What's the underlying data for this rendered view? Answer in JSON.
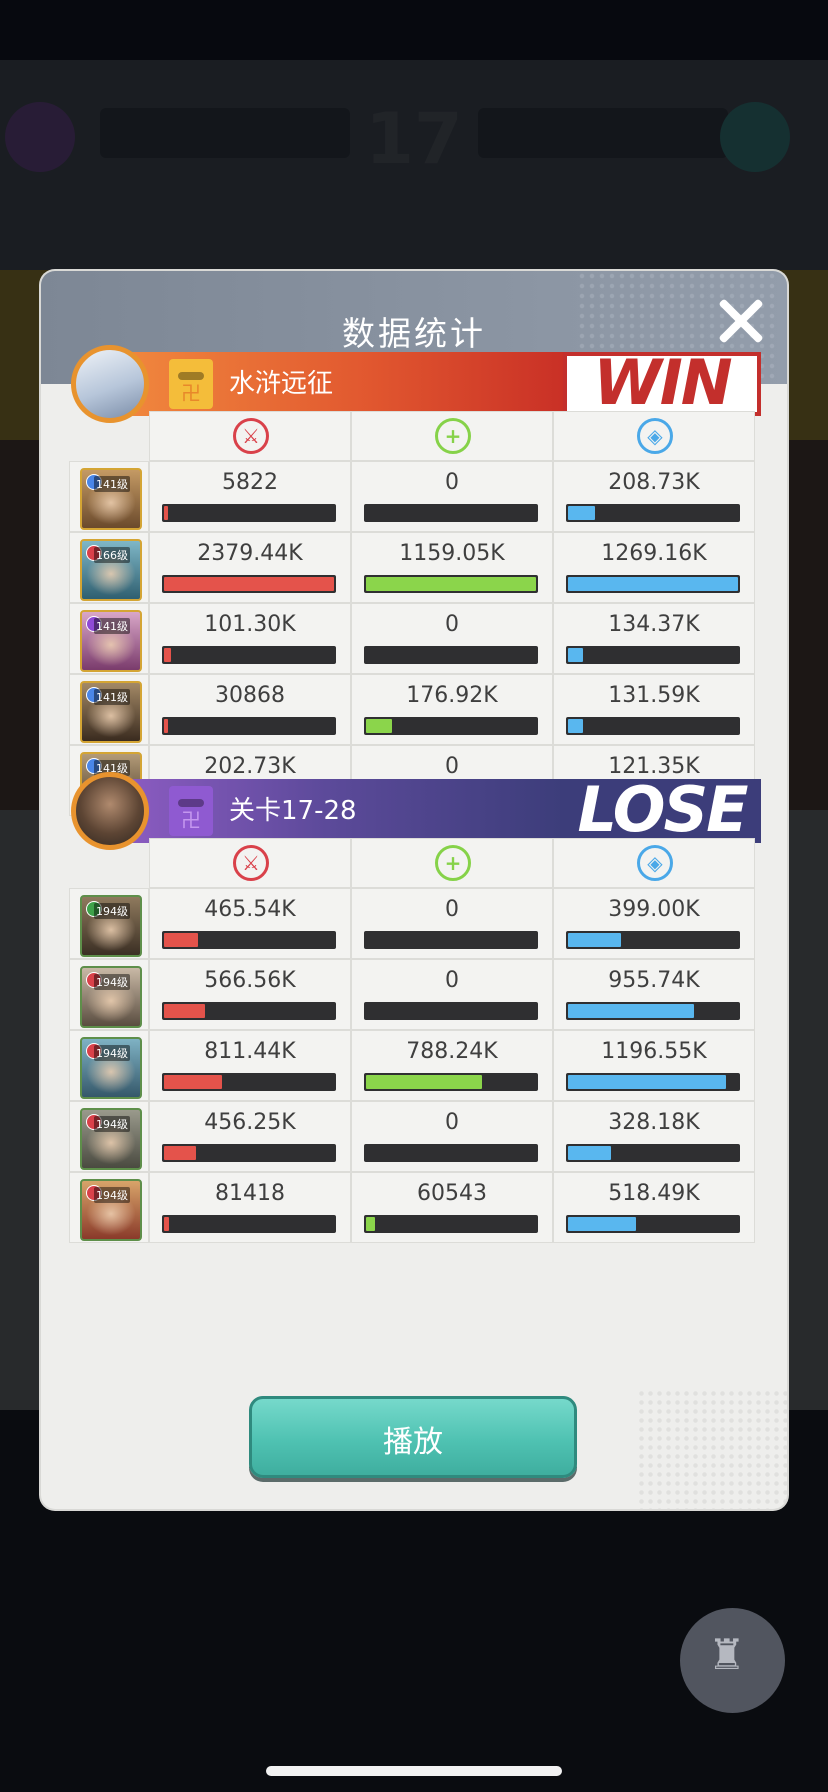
{
  "header": {
    "title": "数据统计"
  },
  "teams": [
    {
      "name": "水浒远征",
      "result": "WIN",
      "heroes": [
        {
          "level": "141级",
          "element": "#4a86e8",
          "dmg": "5822",
          "heal": "0",
          "tank": "208.73K",
          "dmg_frac": 0.002,
          "heal_frac": 0.0,
          "tank_frac": 0.16
        },
        {
          "level": "166级",
          "element": "#d9414a",
          "dmg": "2379.44K",
          "heal": "1159.05K",
          "tank": "1269.16K",
          "dmg_frac": 1.0,
          "heal_frac": 1.0,
          "tank_frac": 1.0
        },
        {
          "level": "141级",
          "element": "#8e49d6",
          "dmg": "101.30K",
          "heal": "0",
          "tank": "134.37K",
          "dmg_frac": 0.04,
          "heal_frac": 0.0,
          "tank_frac": 0.09
        },
        {
          "level": "141级",
          "element": "#4a86e8",
          "dmg": "30868",
          "heal": "176.92K",
          "tank": "131.59K",
          "dmg_frac": 0.01,
          "heal_frac": 0.15,
          "tank_frac": 0.09
        },
        {
          "level": "141级",
          "element": "#4a86e8",
          "dmg": "202.73K",
          "heal": "0",
          "tank": "121.35K",
          "dmg_frac": 0.09,
          "heal_frac": 0.0,
          "tank_frac": 0.08
        }
      ]
    },
    {
      "name": "关卡17-28",
      "result": "LOSE",
      "heroes": [
        {
          "level": "194级",
          "element": "#3fa24a",
          "dmg": "465.54K",
          "heal": "0",
          "tank": "399.00K",
          "dmg_frac": 0.2,
          "heal_frac": 0.0,
          "tank_frac": 0.31
        },
        {
          "level": "194级",
          "element": "#d9414a",
          "dmg": "566.56K",
          "heal": "0",
          "tank": "955.74K",
          "dmg_frac": 0.24,
          "heal_frac": 0.0,
          "tank_frac": 0.74
        },
        {
          "level": "194级",
          "element": "#d9414a",
          "dmg": "811.44K",
          "heal": "788.24K",
          "tank": "1196.55K",
          "dmg_frac": 0.34,
          "heal_frac": 0.68,
          "tank_frac": 0.93
        },
        {
          "level": "194级",
          "element": "#d9414a",
          "dmg": "456.25K",
          "heal": "0",
          "tank": "328.18K",
          "dmg_frac": 0.19,
          "heal_frac": 0.0,
          "tank_frac": 0.25
        },
        {
          "level": "194级",
          "element": "#d9414a",
          "dmg": "81418",
          "heal": "60543",
          "tank": "518.49K",
          "dmg_frac": 0.03,
          "heal_frac": 0.05,
          "tank_frac": 0.4
        }
      ]
    }
  ],
  "icons": {
    "damage": "sword-icon",
    "heal": "plus-icon",
    "tank": "shield-icon",
    "close": "close-icon",
    "team_flag": "banner-icon"
  },
  "play_button": "播放",
  "background": {
    "round_number": "17"
  },
  "colors": {
    "damage": "#e4534b",
    "heal": "#8bd54b",
    "tank": "#59b7ef",
    "win": "#c32f2c",
    "lose": "#3c3d7a",
    "play": "#4fc2b2"
  }
}
